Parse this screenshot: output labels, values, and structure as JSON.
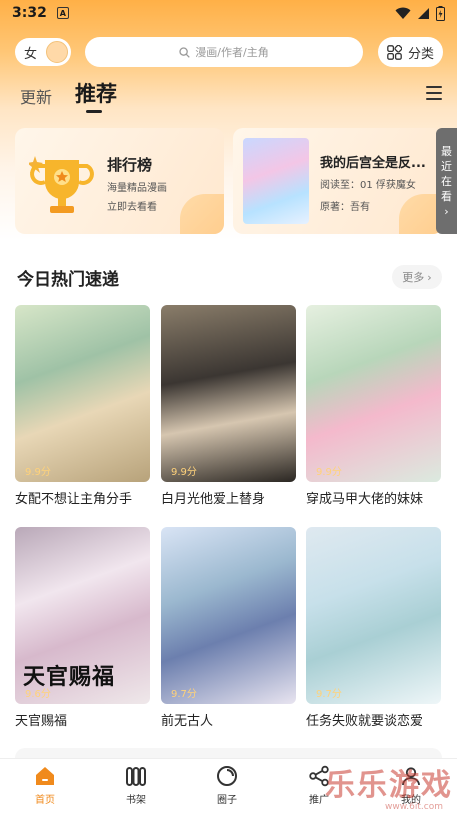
{
  "status_bar": {
    "time": "3:32",
    "notification_glyph": "A"
  },
  "header": {
    "gender_label": "女",
    "search_placeholder": "漫画/作者/主角",
    "category_label": "分类"
  },
  "tabs": {
    "update": "更新",
    "recommend": "推荐",
    "active": "推荐"
  },
  "rank_card": {
    "title": "排行榜",
    "subtitle": "海量精品漫画",
    "cta": "立即去看看"
  },
  "recent_card": {
    "title": "我的后宫全是反...",
    "progress": "阅读至：01 俘获魔女",
    "author": "原著：吾有"
  },
  "recent_tab": {
    "chars": [
      "最",
      "近",
      "在",
      "看"
    ]
  },
  "section": {
    "title": "今日热门速递",
    "more": "更多"
  },
  "comics": [
    {
      "title": "女配不想让主角分手",
      "score": "9.9分"
    },
    {
      "title": "白月光他爱上替身",
      "score": "9.9分"
    },
    {
      "title": "穿成马甲大佬的妹妹",
      "score": "9.9分"
    },
    {
      "title": "天官赐福",
      "score": "9.6分",
      "cover_text": "天官赐福"
    },
    {
      "title": "前无古人",
      "score": "9.7分"
    },
    {
      "title": "任务失败就要谈恋爱",
      "score": "9.7分"
    }
  ],
  "tabbar": [
    {
      "label": "首页",
      "icon": "home-icon",
      "active": true
    },
    {
      "label": "书架",
      "icon": "bookshelf-icon",
      "active": false
    },
    {
      "label": "圈子",
      "icon": "circle-icon",
      "active": false
    },
    {
      "label": "推广",
      "icon": "share-icon",
      "active": false
    },
    {
      "label": "我的",
      "icon": "profile-icon",
      "active": false
    }
  ],
  "watermark": {
    "text": "乐乐游戏",
    "url": "www.6it.com"
  },
  "colors": {
    "accent": "#f08a1c",
    "header_gradient_top": "#ffb047"
  }
}
